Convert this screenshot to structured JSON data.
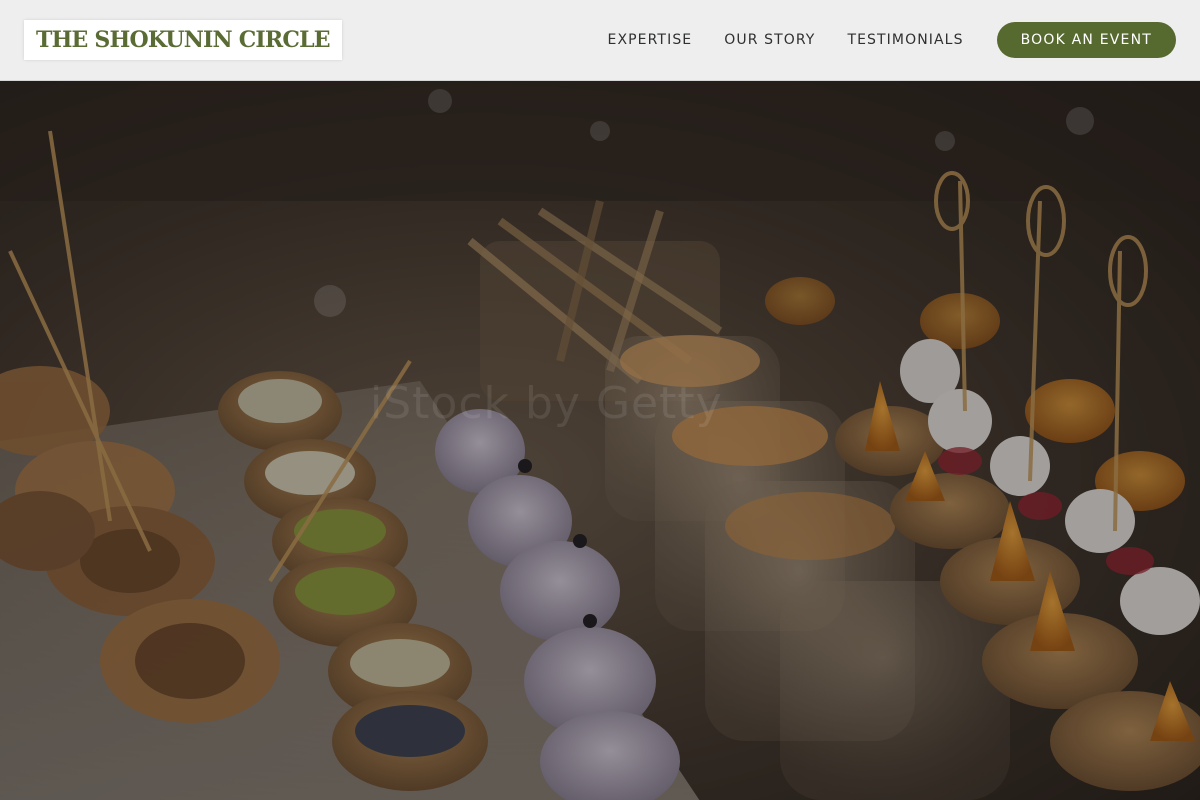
{
  "brand": {
    "name": "THE SHOKUNIN CIRCLE",
    "color": "#5a6b34"
  },
  "nav": {
    "items": [
      {
        "label": "EXPERTISE"
      },
      {
        "label": "OUR STORY"
      },
      {
        "label": "TESTIMONIALS"
      }
    ],
    "cta_label": "BOOK AN EVENT",
    "cta_color": "#566a2f"
  },
  "hero": {
    "image": "catering-canapes-photo",
    "watermark_text": "iStock by Getty"
  }
}
